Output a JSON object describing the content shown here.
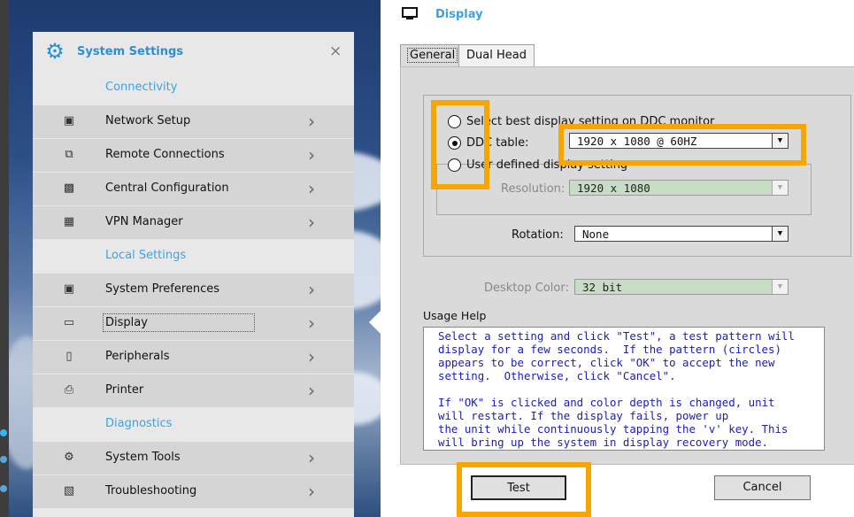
{
  "settings": {
    "title": "System Settings",
    "sections": {
      "connectivity": "Connectivity",
      "local": "Local Settings",
      "diagnostics": "Diagnostics"
    },
    "items": [
      {
        "label": "Network Setup",
        "icon": "network-icon"
      },
      {
        "label": "Remote Connections",
        "icon": "remote-icon"
      },
      {
        "label": "Central Configuration",
        "icon": "central-config-icon"
      },
      {
        "label": "VPN Manager",
        "icon": "vpn-icon"
      },
      {
        "label": "System Preferences",
        "icon": "preferences-icon"
      },
      {
        "label": "Display",
        "icon": "monitor-icon"
      },
      {
        "label": "Peripherals",
        "icon": "mouse-icon"
      },
      {
        "label": "Printer",
        "icon": "printer-icon"
      },
      {
        "label": "System Tools",
        "icon": "tools-icon"
      },
      {
        "label": "Troubleshooting",
        "icon": "troubleshoot-icon"
      }
    ]
  },
  "dialog": {
    "title": "Display",
    "tabs": [
      "General",
      "Dual Head"
    ],
    "options": {
      "best": "Select best display setting on DDC monitor",
      "ddc": "DDC table:",
      "user": "User defined display setting"
    },
    "ddc_value": "1920 x 1080 @ 60HZ",
    "resolution_label": "Resolution:",
    "resolution_value": "1920 x 1080",
    "rotation_label": "Rotation:",
    "rotation_value": "None",
    "color_label": "Desktop Color:",
    "color_value": "32 bit",
    "help_label": "Usage Help",
    "help_text": "Select a setting and click \"Test\", a test pattern will\ndisplay for a few seconds.  If the pattern (circles)\nappears to be correct, click \"OK\" to accept the new\nsetting.  Otherwise, click \"Cancel\".\n\nIf \"OK\" is clicked and color depth is changed, unit\nwill restart. If the display fails, power up\nthe unit while continuously tapping the 'v' key. This\nwill bring up the system in display recovery mode.",
    "test_label": "Test",
    "cancel_label": "Cancel"
  },
  "colors": {
    "accent": "#3aa3e4",
    "highlight": "#f7a500",
    "help_text": "#1c1cb8"
  }
}
